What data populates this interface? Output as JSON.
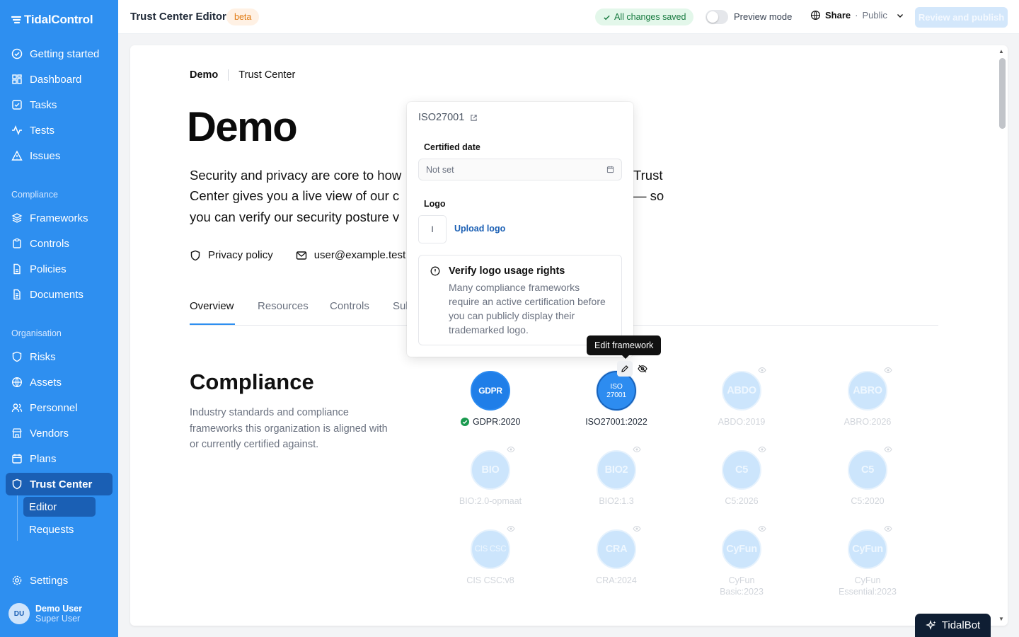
{
  "app": {
    "brand": "TidalControl"
  },
  "sidebar": {
    "nav_top": [
      {
        "label": "Getting started",
        "icon": "check-circle-icon"
      },
      {
        "label": "Dashboard",
        "icon": "grid-icon"
      },
      {
        "label": "Tasks",
        "icon": "checkbox-icon"
      },
      {
        "label": "Tests",
        "icon": "activity-icon"
      },
      {
        "label": "Issues",
        "icon": "warning-icon"
      }
    ],
    "section_compliance": "Compliance",
    "nav_compliance": [
      {
        "label": "Frameworks",
        "icon": "layers-icon"
      },
      {
        "label": "Controls",
        "icon": "clipboard-icon"
      },
      {
        "label": "Policies",
        "icon": "file-icon"
      },
      {
        "label": "Documents",
        "icon": "document-icon"
      }
    ],
    "section_org": "Organisation",
    "nav_org": [
      {
        "label": "Risks",
        "icon": "shield-outline-icon"
      },
      {
        "label": "Assets",
        "icon": "globe-icon"
      },
      {
        "label": "Personnel",
        "icon": "users-icon"
      },
      {
        "label": "Vendors",
        "icon": "store-icon"
      },
      {
        "label": "Plans",
        "icon": "calendar-icon"
      },
      {
        "label": "Trust Center",
        "icon": "shield-icon"
      }
    ],
    "sub_items": [
      {
        "label": "Editor"
      },
      {
        "label": "Requests"
      }
    ],
    "settings": "Settings",
    "user": {
      "initials": "DU",
      "name": "Demo User",
      "role": "Super User"
    }
  },
  "topbar": {
    "title": "Trust Center Editor",
    "beta": "beta",
    "saved": "All changes saved",
    "preview": "Preview mode",
    "share": "Share",
    "share_visibility": "Public",
    "publish": "Review and publish"
  },
  "page": {
    "breadcrumb": [
      "Demo",
      "Trust Center"
    ],
    "title": "Demo",
    "description": "Security and privacy are core to how we build. This Trust Center gives you a live view of our compliance and controls — so you can verify our security posture yourself.",
    "description_visible_lines": [
      "Security and privacy are core to how",
      "Trust",
      "Center gives you a live view of our c",
      "— so",
      "you can verify our security posture v"
    ],
    "privacy_link": "Privacy policy",
    "email": "user@example.test",
    "tabs": [
      "Overview",
      "Resources",
      "Controls",
      "Sul"
    ],
    "section_title": "Compliance",
    "section_desc": "Industry standards and compliance frameworks this organization is aligned with or currently certified against."
  },
  "frameworks": [
    {
      "badge": "GDPR",
      "label": "GDPR:2020",
      "state": "certified"
    },
    {
      "badge": "ISO 27001",
      "label": "ISO27001:2022",
      "state": "selected"
    },
    {
      "badge": "ABDO",
      "label": "ABDO:2019",
      "state": "hidden"
    },
    {
      "badge": "ABRO",
      "label": "ABRO:2026",
      "state": "hidden"
    },
    {
      "badge": "BIO",
      "label": "BIO:2.0-opmaat",
      "state": "hidden"
    },
    {
      "badge": "BIO2",
      "label": "BIO2:1.3",
      "state": "hidden"
    },
    {
      "badge": "C5",
      "label": "C5:2026",
      "state": "hidden"
    },
    {
      "badge": "C5",
      "label": "C5:2020",
      "state": "hidden"
    },
    {
      "badge": "CIS CSC",
      "label": "CIS CSC:v8",
      "state": "hidden"
    },
    {
      "badge": "CRA",
      "label": "CRA:2024",
      "state": "hidden"
    },
    {
      "badge": "CyFun",
      "label": "CyFun Basic:2023",
      "state": "hidden"
    },
    {
      "badge": "CyFun",
      "label": "CyFun Essential:2023",
      "state": "hidden"
    }
  ],
  "popover": {
    "title": "ISO27001",
    "certified_label": "Certified date",
    "certified_value": "Not set",
    "logo_label": "Logo",
    "logo_placeholder": "I",
    "upload": "Upload logo",
    "alert_title": "Verify logo usage rights",
    "alert_body": "Many compliance frameworks require an active certification before you can publicly display their trademarked logo."
  },
  "tooltip": "Edit framework",
  "tidalbot": "TidalBot",
  "colors": {
    "brand": "#2e8ff0",
    "brand_dark": "#1a5fb4",
    "success": "#177a3f"
  }
}
